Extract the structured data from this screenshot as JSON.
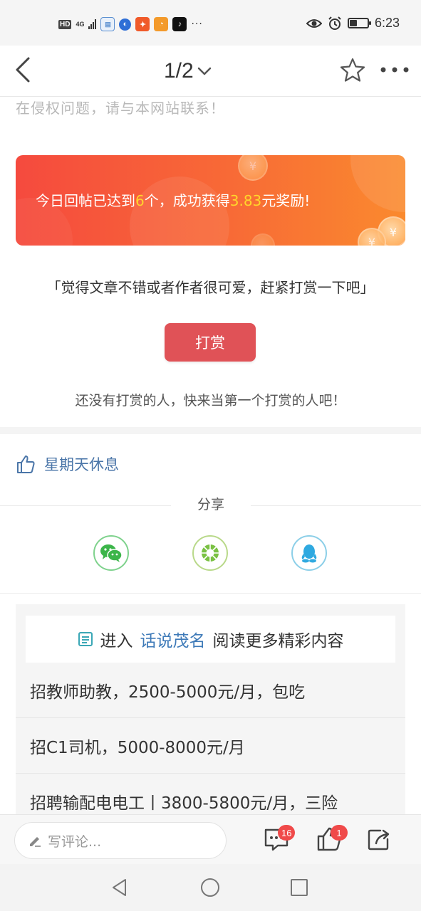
{
  "status_bar": {
    "hd_label": "HD",
    "network_label": "4G",
    "time": "6:23",
    "more_dots": "···",
    "app_icons": [
      "notes-app-icon",
      "browser-app-icon",
      "fitness-app-icon",
      "uc-browser-icon",
      "tiktok-icon"
    ]
  },
  "nav": {
    "page_indicator": "1/2"
  },
  "notice_text": "在侵权问题，请与本网站联系！",
  "reward_banner": {
    "prefix": "今日回帖已达到",
    "count": "6",
    "middle": "个，成功获得",
    "amount": "3.83",
    "suffix": "元奖励!",
    "coin_symbol": "¥"
  },
  "tip": {
    "quote": "「觉得文章不错或者作者很可爱，赶紧打赏一下吧」",
    "button_label": "打赏",
    "empty_text": "还没有打赏的人，快来当第一个打赏的人吧！"
  },
  "like": {
    "text": "星期天休息"
  },
  "share": {
    "title": "分享",
    "targets": [
      "wechat",
      "moments",
      "qq"
    ]
  },
  "more": {
    "prefix": "进入",
    "link": "话说茂名",
    "suffix": "阅读更多精彩内容",
    "items": [
      "招教师助教，2500-5000元/月，包吃",
      "招C1司机，5000-8000元/月",
      "招聘输配电电工丨3800-5800元/月，三险"
    ]
  },
  "comment_bar": {
    "placeholder": "写评论...",
    "comment_count": "16",
    "like_count": "1"
  },
  "colors": {
    "accent_red": "#e05257",
    "link_blue": "#4a75a8",
    "highlight_yellow": "#ffd62b",
    "badge_red": "#f04a4a"
  }
}
